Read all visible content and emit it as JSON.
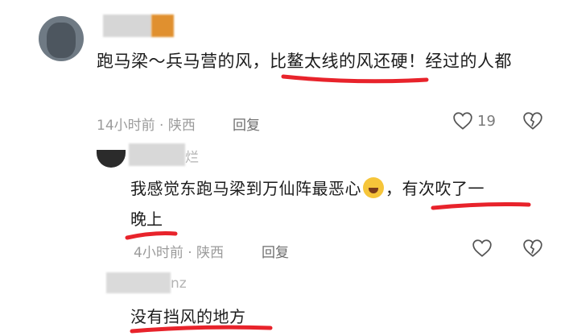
{
  "main_comment": {
    "text": "跑马梁～兵马营的风，比鳌太线的风还硬！经过的人都",
    "time": "14小时前",
    "sep": "·",
    "location": "陕西",
    "reply_label": "回复",
    "like_count": "19"
  },
  "reply1": {
    "name_tail": "烂",
    "text_before_emoji": "我感觉东跑马梁到万仙阵最恶心",
    "text_after_emoji": "，有次吹了一",
    "text_line2": "晚上",
    "time": "4小时前",
    "sep": "·",
    "location": "陕西",
    "reply_label": "回复"
  },
  "reply2": {
    "name_tail": "nz",
    "text": "没有挡风的地方"
  },
  "colors": {
    "underline": "#e8232b",
    "meta": "#9b9b9b",
    "text": "#1c1c1c"
  },
  "icons": [
    "heart-outline-icon",
    "broken-heart-icon",
    "laughing-crying-emoji"
  ]
}
